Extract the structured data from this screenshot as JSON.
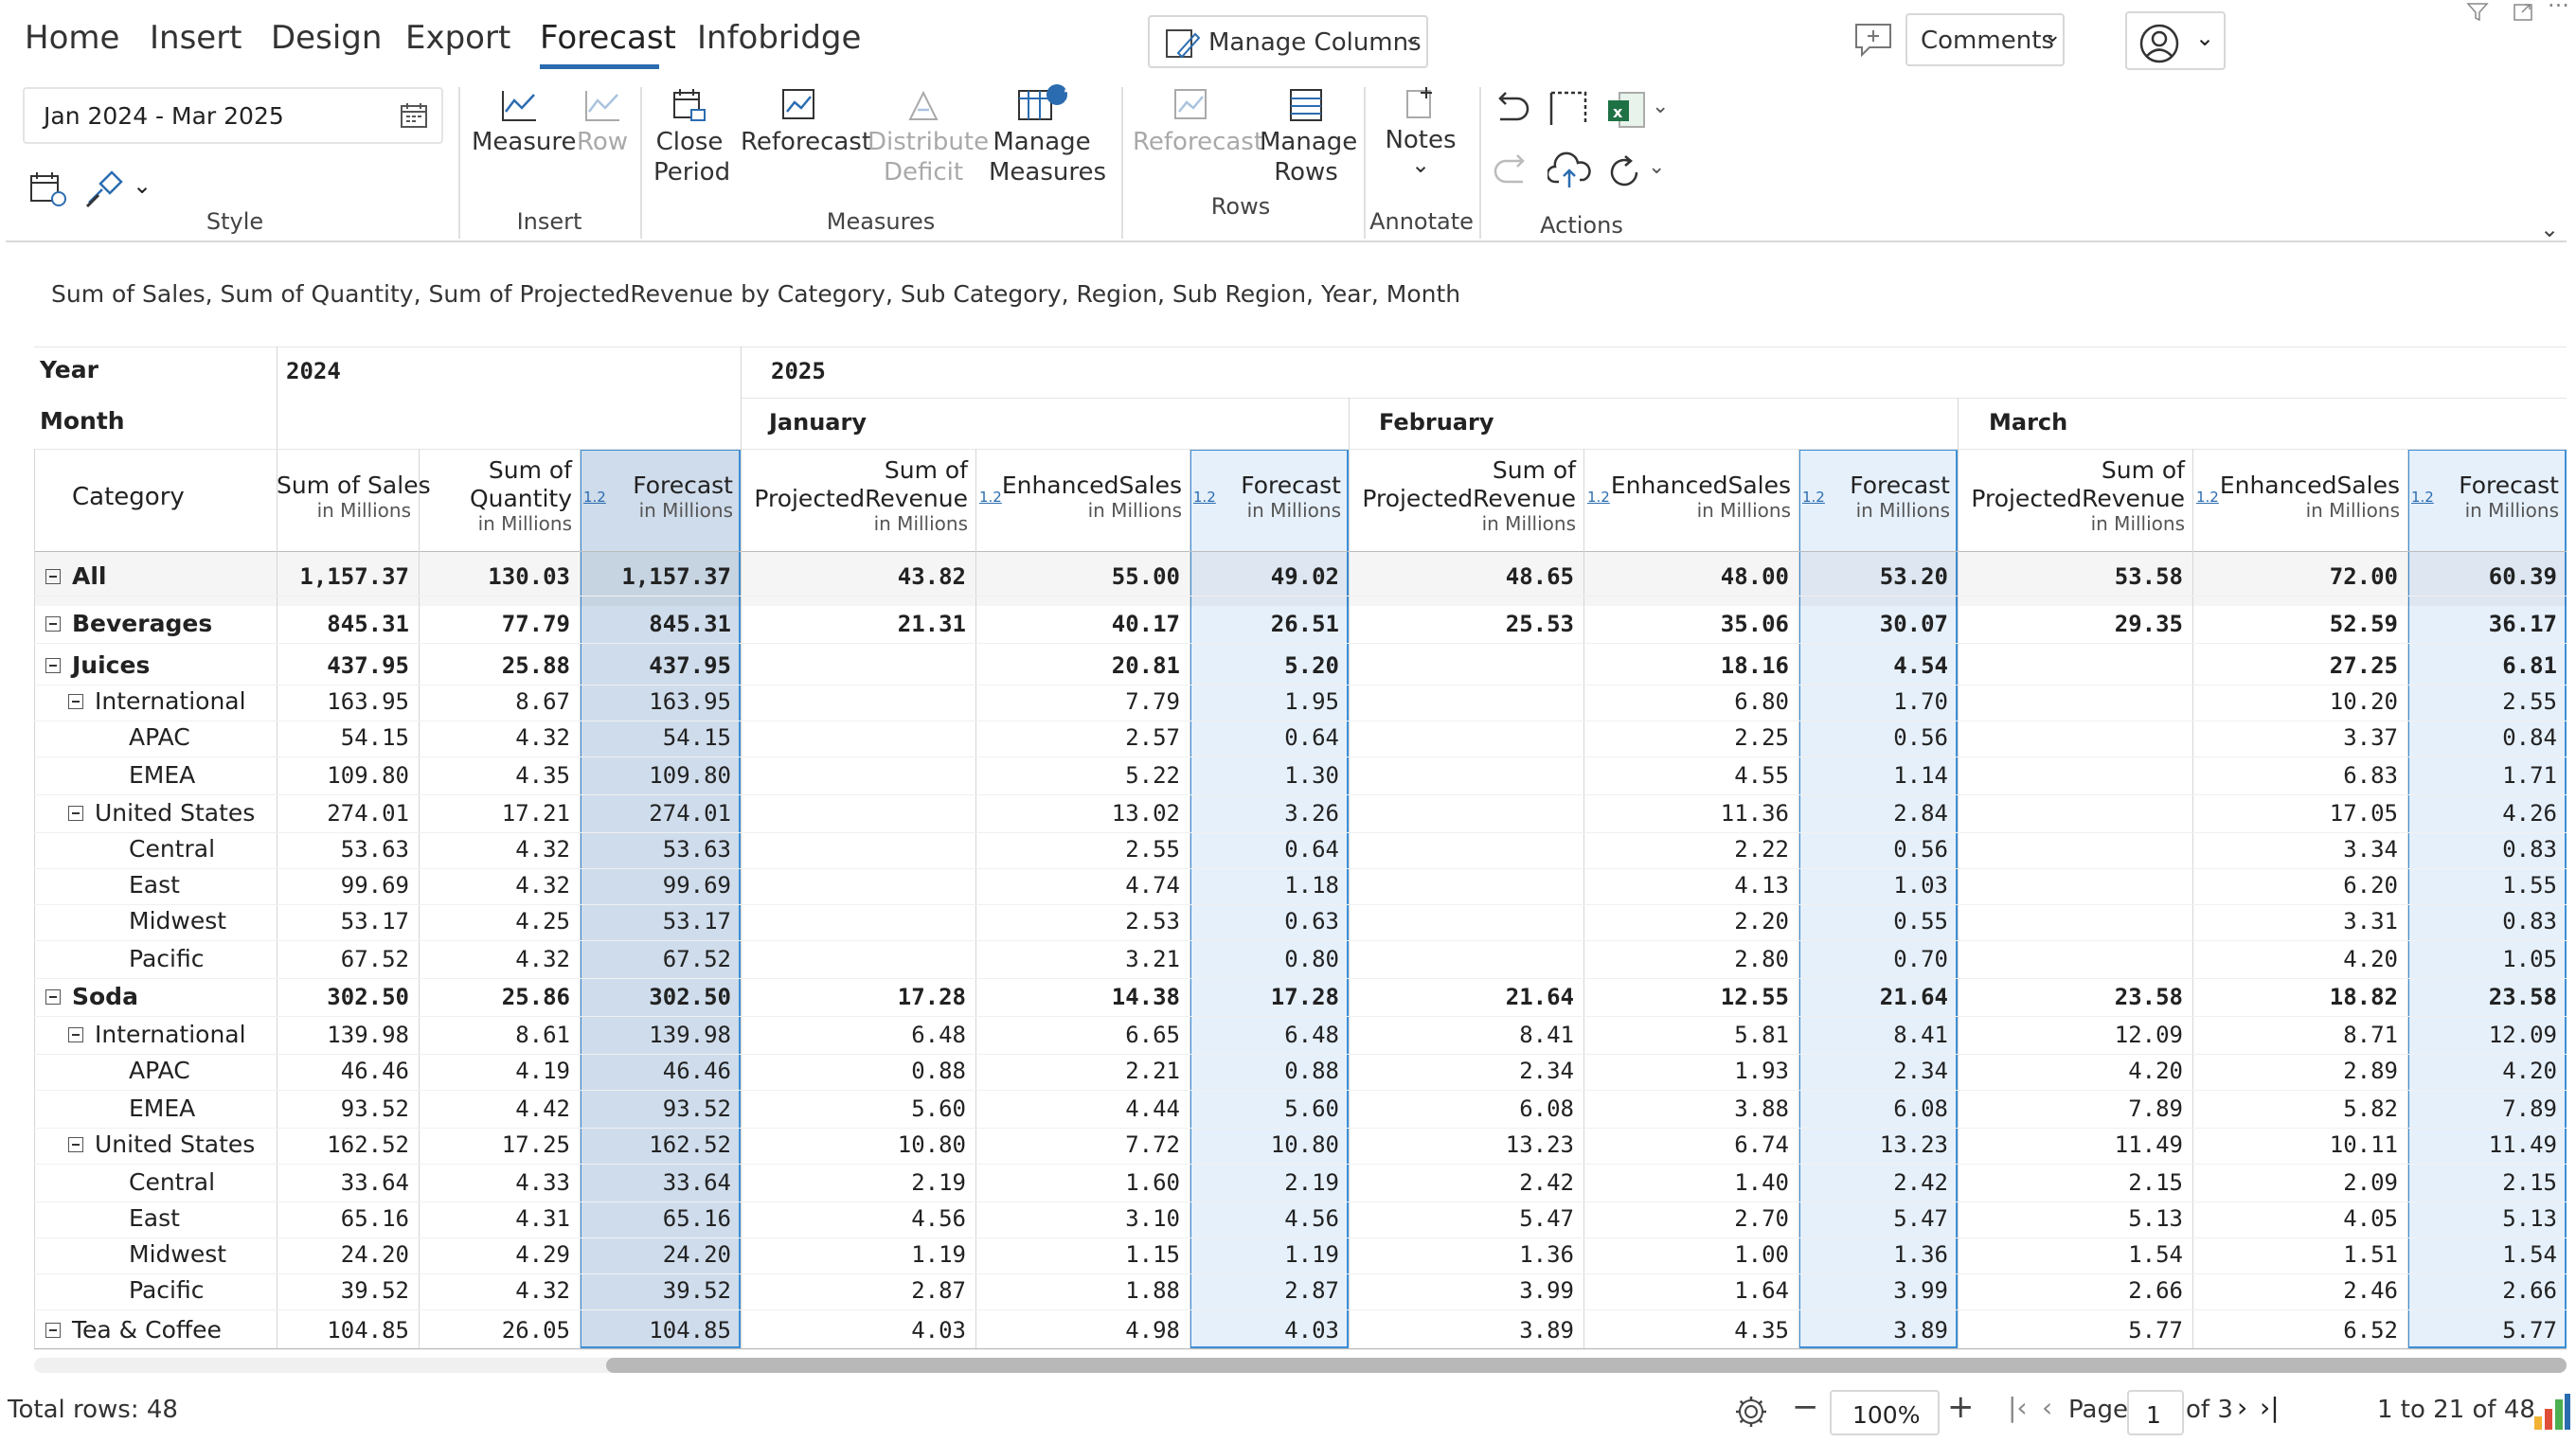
{
  "menu": {
    "tabs": [
      "Home",
      "Insert",
      "Design",
      "Export",
      "Forecast",
      "Infobridge"
    ],
    "active": "Forecast",
    "manage_columns": "Manage Columns",
    "comments": "Comments"
  },
  "ribbon": {
    "date_range": "Jan 2024 - Mar 2025",
    "style_label": "Style",
    "insert_group": {
      "label": "Insert",
      "measure": "Measure",
      "row": "Row"
    },
    "measures_group": {
      "label": "Measures",
      "close_period_1": "Close",
      "close_period_2": "Period",
      "reforecast": "Reforecast",
      "distribute_1": "Distribute",
      "distribute_2": "Deficit",
      "manage_measures_1": "Manage",
      "manage_measures_2": "Measures",
      "manage_measures_badge": "1"
    },
    "rows_group": {
      "label": "Rows",
      "reforecast": "Reforecast",
      "manage_rows_1": "Manage",
      "manage_rows_2": "Rows"
    },
    "annotate_group": {
      "label": "Annotate",
      "notes": "Notes"
    },
    "actions_group": {
      "label": "Actions"
    }
  },
  "subtitle": "Sum of Sales, Sum of Quantity, Sum of ProjectedRevenue by Category, Sub Category, Region, Sub Region, Year, Month",
  "grid": {
    "year_label": "Year",
    "month_label": "Month",
    "category_label": "Category",
    "years": [
      "2024",
      "2025"
    ],
    "months": [
      "January",
      "February",
      "March"
    ],
    "badge": "1.2",
    "headers_2024": [
      {
        "l1": "Sum of Sales",
        "unit": "in Millions"
      },
      {
        "l1": "Sum of",
        "l2": "Quantity",
        "unit": "in Millions"
      },
      {
        "l1": "Forecast",
        "unit": "in Millions"
      }
    ],
    "headers_month": [
      {
        "l1": "Sum of",
        "l2": "ProjectedRevenue",
        "unit": "in Millions"
      },
      {
        "l1": "EnhancedSales",
        "unit": "in Millions"
      },
      {
        "l1": "Forecast",
        "unit": "in Millions"
      }
    ],
    "rows": [
      {
        "label": "All",
        "level": 0,
        "toggle": true,
        "bold": true,
        "v": [
          "1,157.37",
          "130.03",
          "1,157.37",
          "43.82",
          "55.00",
          "49.02",
          "48.65",
          "48.00",
          "53.20",
          "53.58",
          "72.00",
          "60.39"
        ]
      },
      {
        "label": "Beverages",
        "level": 0,
        "toggle": true,
        "bold": true,
        "v": [
          "845.31",
          "77.79",
          "845.31",
          "21.31",
          "40.17",
          "26.51",
          "25.53",
          "35.06",
          "30.07",
          "29.35",
          "52.59",
          "36.17"
        ]
      },
      {
        "label": "Juices",
        "level": 1,
        "toggle": true,
        "bold": true,
        "v": [
          "437.95",
          "25.88",
          "437.95",
          "",
          "20.81",
          "5.20",
          "",
          "18.16",
          "4.54",
          "",
          "27.25",
          "6.81"
        ]
      },
      {
        "label": "International",
        "level": 2,
        "toggle": true,
        "bold": false,
        "v": [
          "163.95",
          "8.67",
          "163.95",
          "",
          "7.79",
          "1.95",
          "",
          "6.80",
          "1.70",
          "",
          "10.20",
          "2.55"
        ]
      },
      {
        "label": "APAC",
        "level": 3,
        "toggle": false,
        "bold": false,
        "v": [
          "54.15",
          "4.32",
          "54.15",
          "",
          "2.57",
          "0.64",
          "",
          "2.25",
          "0.56",
          "",
          "3.37",
          "0.84"
        ]
      },
      {
        "label": "EMEA",
        "level": 3,
        "toggle": false,
        "bold": false,
        "v": [
          "109.80",
          "4.35",
          "109.80",
          "",
          "5.22",
          "1.30",
          "",
          "4.55",
          "1.14",
          "",
          "6.83",
          "1.71"
        ]
      },
      {
        "label": "United States",
        "level": 2,
        "toggle": true,
        "bold": false,
        "v": [
          "274.01",
          "17.21",
          "274.01",
          "",
          "13.02",
          "3.26",
          "",
          "11.36",
          "2.84",
          "",
          "17.05",
          "4.26"
        ]
      },
      {
        "label": "Central",
        "level": 3,
        "toggle": false,
        "bold": false,
        "v": [
          "53.63",
          "4.32",
          "53.63",
          "",
          "2.55",
          "0.64",
          "",
          "2.22",
          "0.56",
          "",
          "3.34",
          "0.83"
        ]
      },
      {
        "label": "East",
        "level": 3,
        "toggle": false,
        "bold": false,
        "v": [
          "99.69",
          "4.32",
          "99.69",
          "",
          "4.74",
          "1.18",
          "",
          "4.13",
          "1.03",
          "",
          "6.20",
          "1.55"
        ]
      },
      {
        "label": "Midwest",
        "level": 3,
        "toggle": false,
        "bold": false,
        "v": [
          "53.17",
          "4.25",
          "53.17",
          "",
          "2.53",
          "0.63",
          "",
          "2.20",
          "0.55",
          "",
          "3.31",
          "0.83"
        ]
      },
      {
        "label": "Pacific",
        "level": 3,
        "toggle": false,
        "bold": false,
        "v": [
          "67.52",
          "4.32",
          "67.52",
          "",
          "3.21",
          "0.80",
          "",
          "2.80",
          "0.70",
          "",
          "4.20",
          "1.05"
        ]
      },
      {
        "label": "Soda",
        "level": 1,
        "toggle": true,
        "bold": true,
        "v": [
          "302.50",
          "25.86",
          "302.50",
          "17.28",
          "14.38",
          "17.28",
          "21.64",
          "12.55",
          "21.64",
          "23.58",
          "18.82",
          "23.58"
        ]
      },
      {
        "label": "International",
        "level": 2,
        "toggle": true,
        "bold": false,
        "v": [
          "139.98",
          "8.61",
          "139.98",
          "6.48",
          "6.65",
          "6.48",
          "8.41",
          "5.81",
          "8.41",
          "12.09",
          "8.71",
          "12.09"
        ]
      },
      {
        "label": "APAC",
        "level": 3,
        "toggle": false,
        "bold": false,
        "v": [
          "46.46",
          "4.19",
          "46.46",
          "0.88",
          "2.21",
          "0.88",
          "2.34",
          "1.93",
          "2.34",
          "4.20",
          "2.89",
          "4.20"
        ]
      },
      {
        "label": "EMEA",
        "level": 3,
        "toggle": false,
        "bold": false,
        "v": [
          "93.52",
          "4.42",
          "93.52",
          "5.60",
          "4.44",
          "5.60",
          "6.08",
          "3.88",
          "6.08",
          "7.89",
          "5.82",
          "7.89"
        ]
      },
      {
        "label": "United States",
        "level": 2,
        "toggle": true,
        "bold": false,
        "v": [
          "162.52",
          "17.25",
          "162.52",
          "10.80",
          "7.72",
          "10.80",
          "13.23",
          "6.74",
          "13.23",
          "11.49",
          "10.11",
          "11.49"
        ]
      },
      {
        "label": "Central",
        "level": 3,
        "toggle": false,
        "bold": false,
        "v": [
          "33.64",
          "4.33",
          "33.64",
          "2.19",
          "1.60",
          "2.19",
          "2.42",
          "1.40",
          "2.42",
          "2.15",
          "2.09",
          "2.15"
        ]
      },
      {
        "label": "East",
        "level": 3,
        "toggle": false,
        "bold": false,
        "v": [
          "65.16",
          "4.31",
          "65.16",
          "4.56",
          "3.10",
          "4.56",
          "5.47",
          "2.70",
          "5.47",
          "5.13",
          "4.05",
          "5.13"
        ]
      },
      {
        "label": "Midwest",
        "level": 3,
        "toggle": false,
        "bold": false,
        "v": [
          "24.20",
          "4.29",
          "24.20",
          "1.19",
          "1.15",
          "1.19",
          "1.36",
          "1.00",
          "1.36",
          "1.54",
          "1.51",
          "1.54"
        ]
      },
      {
        "label": "Pacific",
        "level": 3,
        "toggle": false,
        "bold": false,
        "v": [
          "39.52",
          "4.32",
          "39.52",
          "2.87",
          "1.88",
          "2.87",
          "3.99",
          "1.64",
          "3.99",
          "2.66",
          "2.46",
          "2.66"
        ]
      },
      {
        "label": "Tea & Coffee",
        "level": 1,
        "toggle": true,
        "bold": false,
        "v": [
          "104.85",
          "26.05",
          "104.85",
          "4.03",
          "4.98",
          "4.03",
          "3.89",
          "4.35",
          "3.89",
          "5.77",
          "6.52",
          "5.77"
        ]
      }
    ]
  },
  "footer": {
    "total_rows": "Total rows: 48",
    "zoom": "100%",
    "page_label": "Page",
    "page_value": "1",
    "of_pages": "of 3",
    "range": "1 to 21 of 48"
  },
  "colors": {
    "accent": "#2b6cb0",
    "forecast_2024": "#cfdceb",
    "forecast_2025": "#e6f0fb",
    "forecast_border": "#3d8fd6"
  }
}
